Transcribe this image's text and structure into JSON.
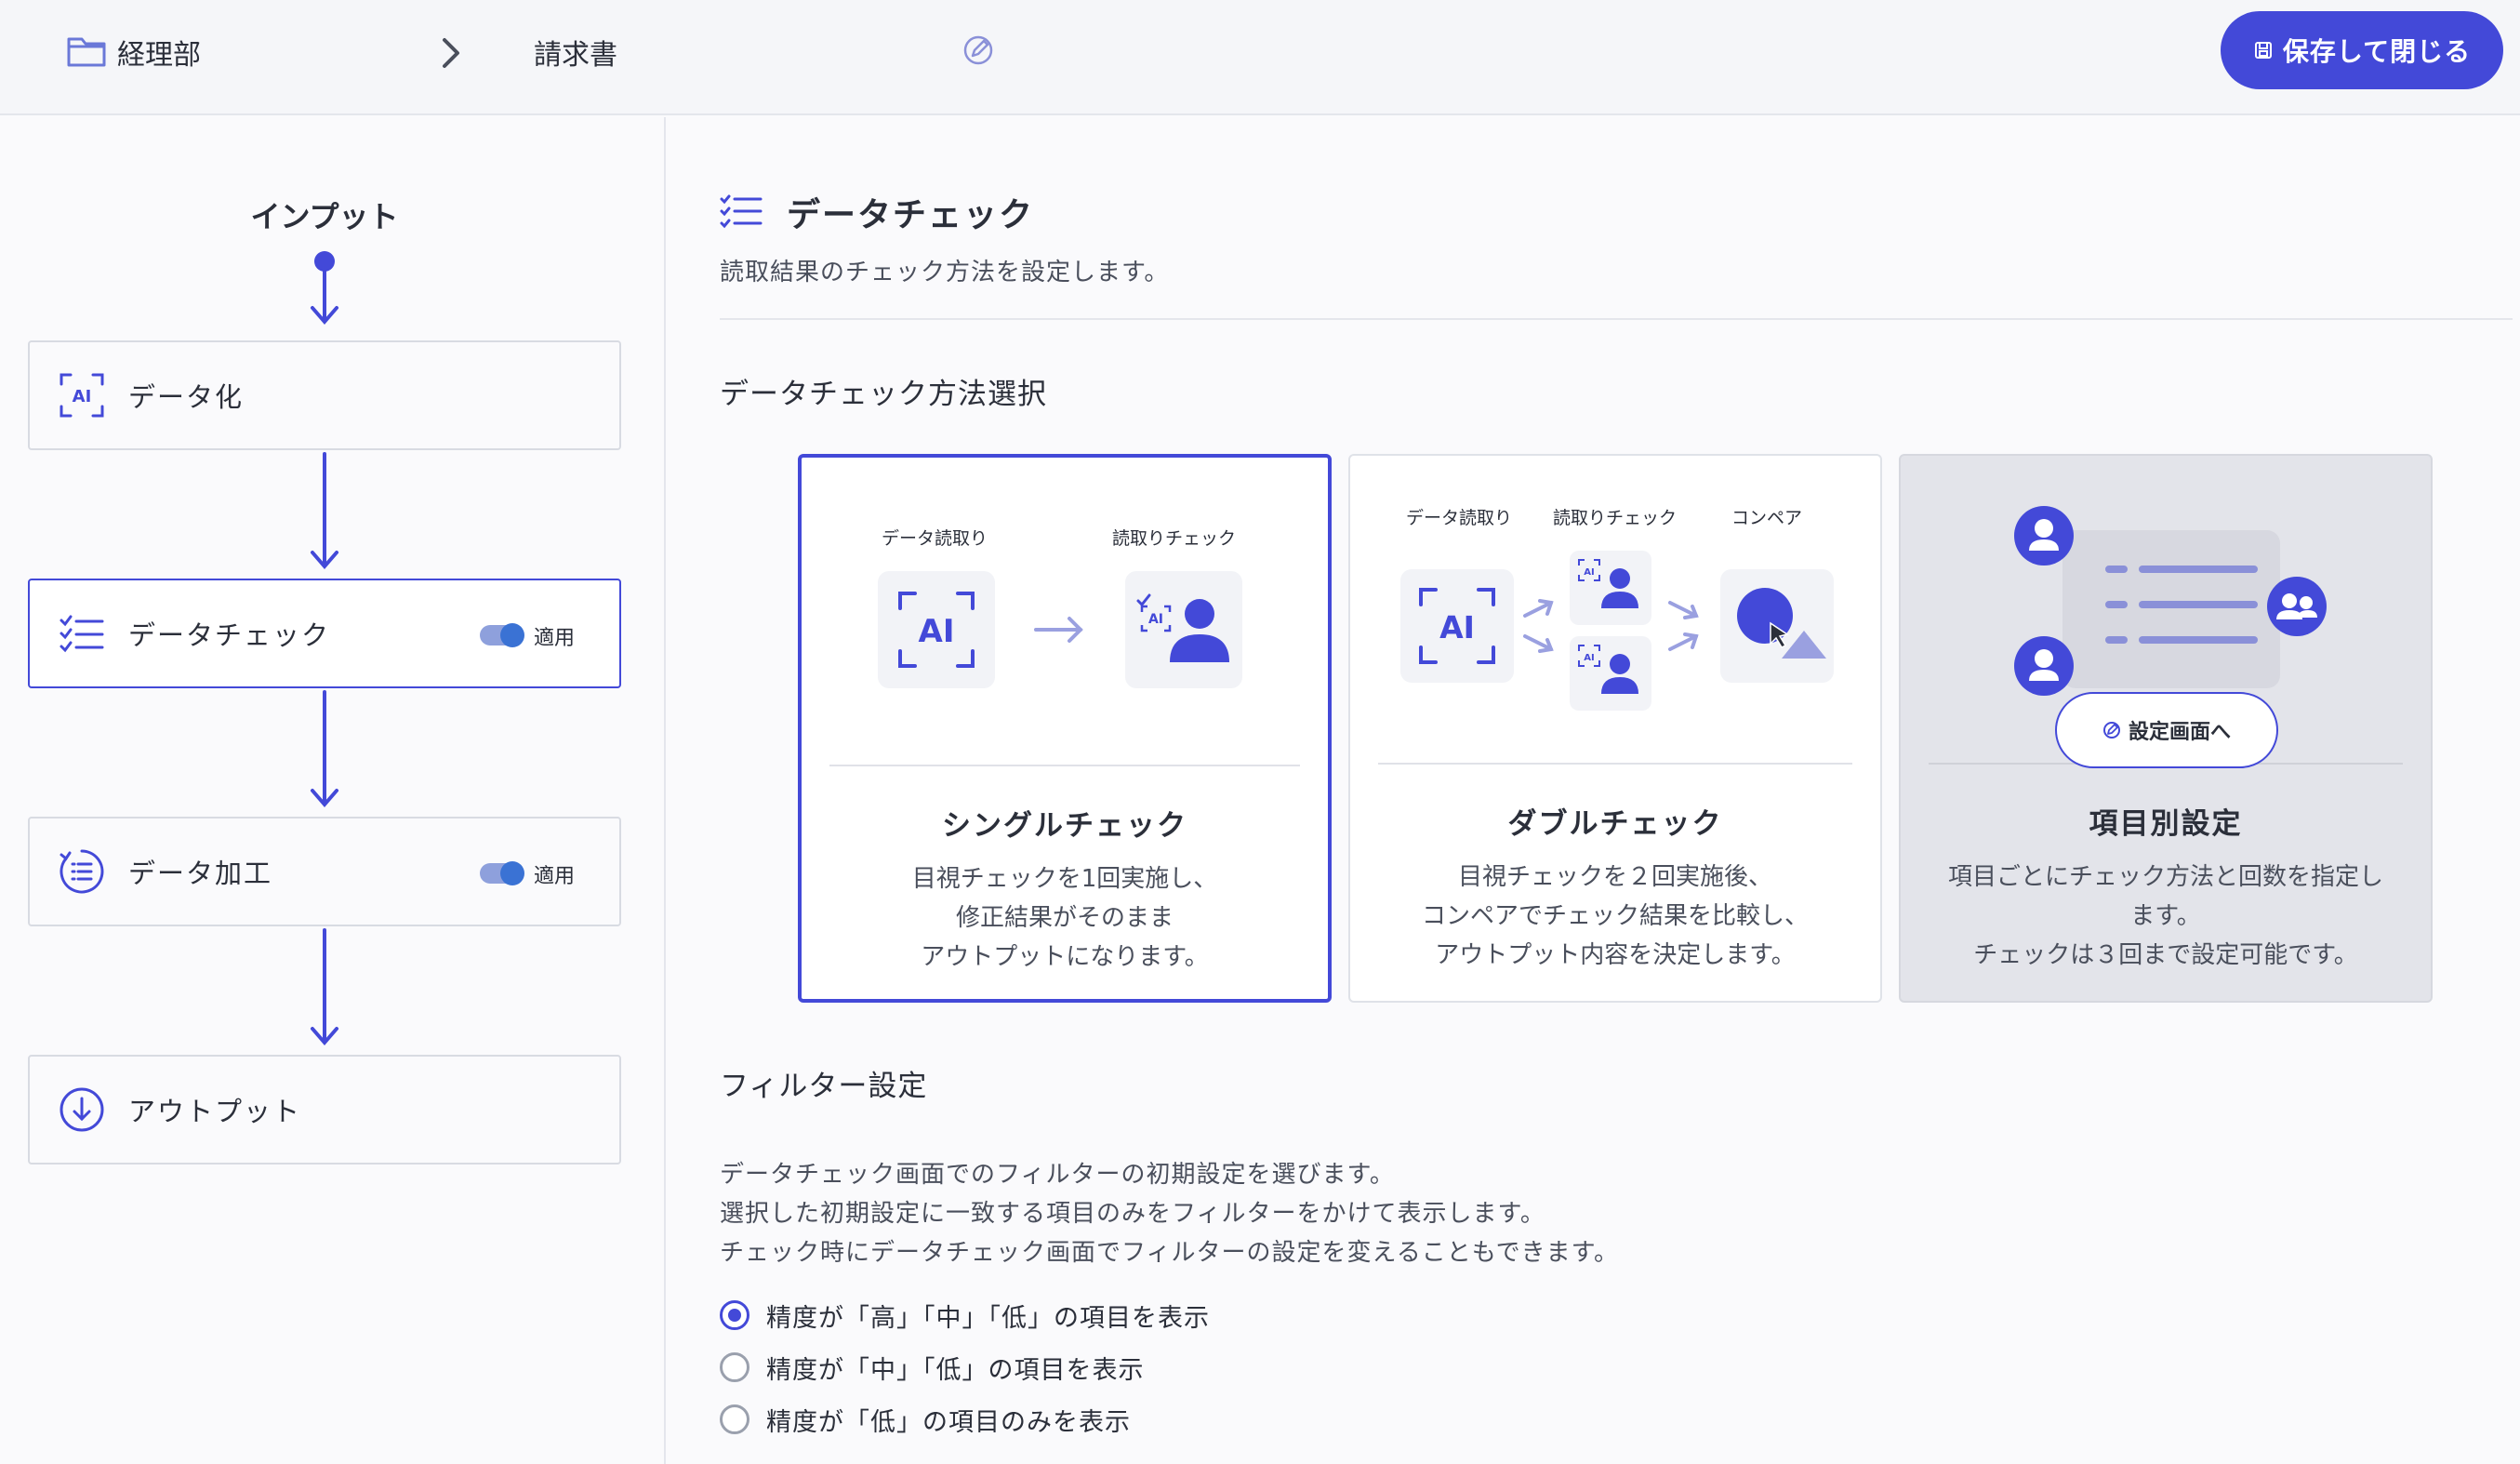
{
  "header": {
    "department": "経理部",
    "document": "請求書",
    "save_button": "保存して閉じる"
  },
  "flow": {
    "input_label": "インプット",
    "nodes": [
      {
        "label": "データ化",
        "icon": "ai-scan-icon"
      },
      {
        "label": "データチェック",
        "icon": "checklist-icon",
        "toggle_label": "適用",
        "toggle_on": true
      },
      {
        "label": "データ加工",
        "icon": "process-list-icon",
        "toggle_label": "適用",
        "toggle_on": true
      },
      {
        "label": "アウトプット",
        "icon": "download-circle-icon"
      }
    ]
  },
  "section": {
    "title": "データチェック",
    "description": "読取結果のチェック方法を設定します。",
    "method_title": "データチェック方法選択"
  },
  "cards": [
    {
      "title": "シングルチェック",
      "desc": [
        "目視チェックを1回実施し、",
        "修正結果がそのまま",
        "アウトプットになります。"
      ],
      "labels": [
        "データ読取り",
        "読取りチェック"
      ],
      "selected": true
    },
    {
      "title": "ダブルチェック",
      "desc": [
        "目視チェックを２回実施後、",
        "コンペアでチェック結果を比較し、",
        "アウトプット内容を決定します。"
      ],
      "labels": [
        "データ読取り",
        "読取りチェック",
        "コンペア"
      ],
      "selected": false
    },
    {
      "title": "項目別設定",
      "desc": [
        "項目ごとにチェック方法と回数を指定し",
        "ます。",
        "チェックは３回まで設定可能です。"
      ],
      "button": "設定画面へ",
      "selected": false
    }
  ],
  "filter": {
    "title": "フィルター設定",
    "desc": [
      "データチェック画面でのフィルターの初期設定を選びます。",
      "選択した初期設定に一致する項目のみをフィルターをかけて表示します。",
      "チェック時にデータチェック画面でフィルターの設定を変えることもできます。"
    ],
    "options": [
      {
        "label": "精度が「高」「中」「低」の項目を表示",
        "checked": true
      },
      {
        "label": "精度が「中」「低」の項目を表示",
        "checked": false
      },
      {
        "label": "精度が「低」の項目のみを表示",
        "checked": false
      }
    ]
  },
  "colors": {
    "accent": "#4349d8",
    "toggle": "#3a72d4",
    "icon_tile": "#f2f3f7"
  }
}
